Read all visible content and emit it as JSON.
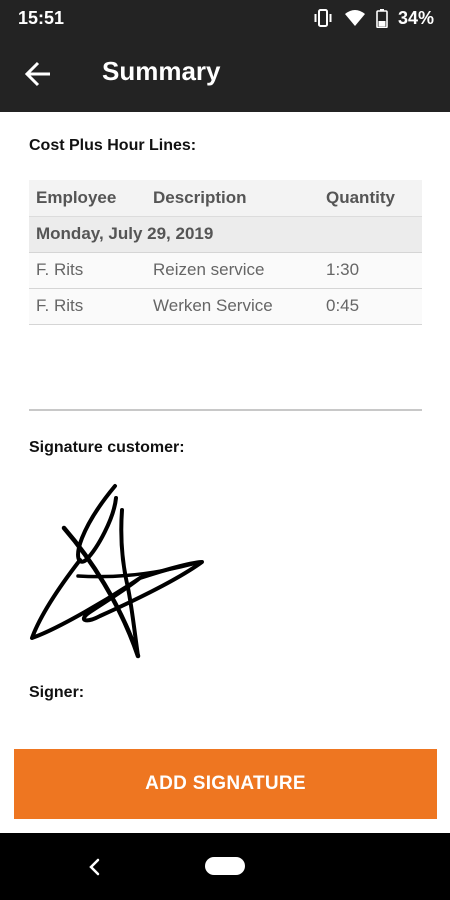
{
  "status_bar": {
    "time": "15:51",
    "battery": "34%",
    "icons": [
      "vibrate-icon",
      "wifi-icon",
      "battery-icon"
    ]
  },
  "app_bar": {
    "title": "Summary",
    "back_icon": "arrow-left-icon"
  },
  "cost_section": {
    "title": "Cost Plus Hour Lines:",
    "columns": [
      "Employee",
      "Description",
      "Quantity"
    ],
    "date_label": "Monday, July 29, 2019",
    "rows": [
      {
        "employee": "F. Rits",
        "description": "Reizen service",
        "quantity": "1:30"
      },
      {
        "employee": "F. Rits",
        "description": "Werken Service",
        "quantity": "0:45"
      }
    ]
  },
  "signature_section": {
    "title": "Signature customer:",
    "signer_label": "Signer:"
  },
  "actions": {
    "add_signature_label": "ADD SIGNATURE"
  },
  "colors": {
    "app_bar_bg": "#232323",
    "accent": "#ee7621",
    "nav_bar_bg": "#000000"
  }
}
